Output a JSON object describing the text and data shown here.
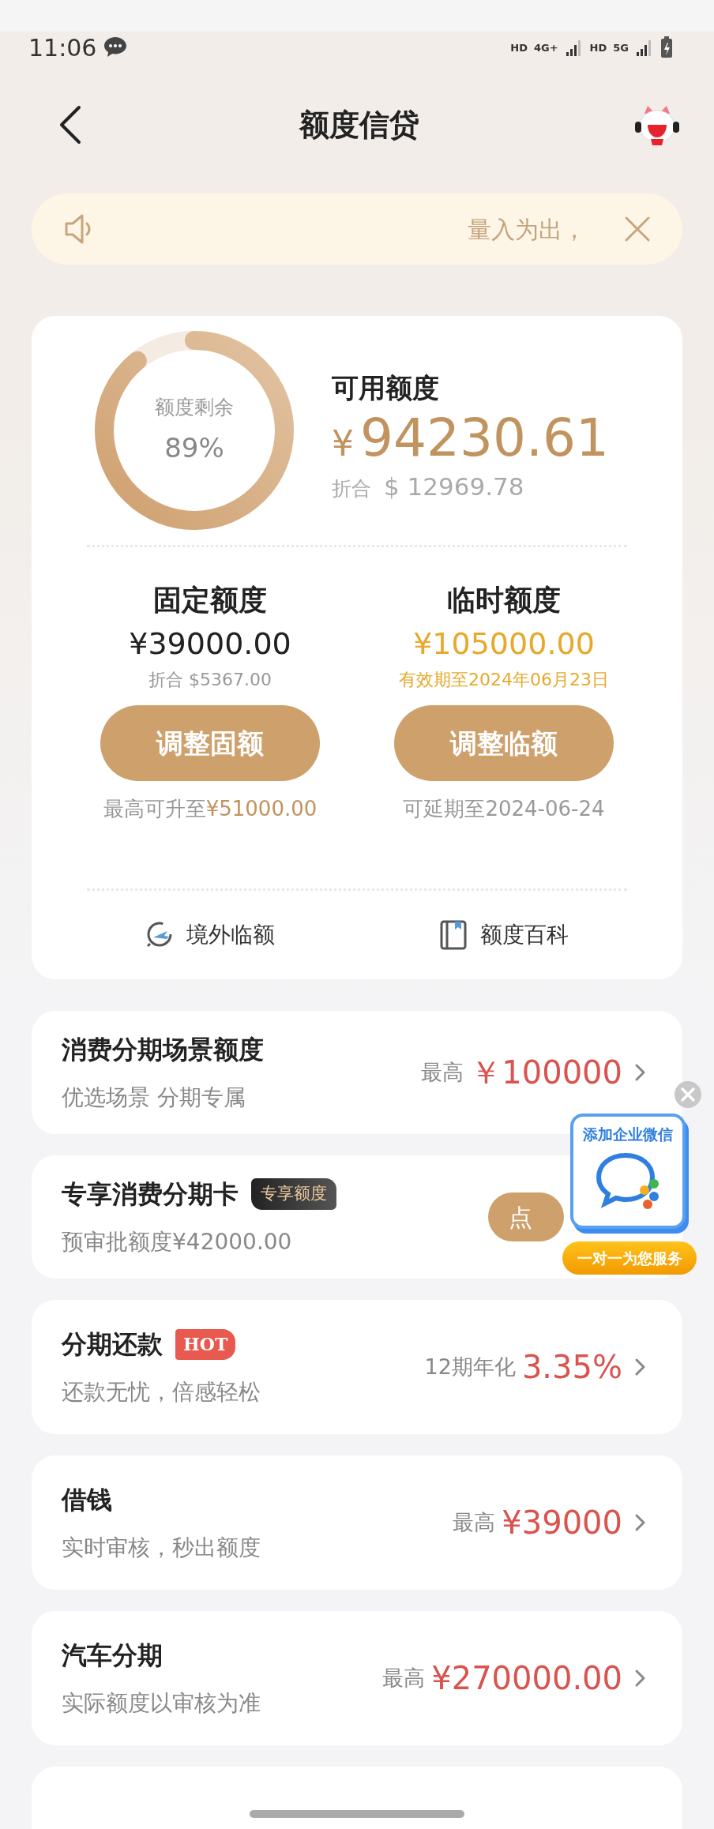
{
  "status_bar": {
    "time": "11:06",
    "indicators": [
      "HD",
      "4G+",
      "HD",
      "5G"
    ]
  },
  "header": {
    "title": "额度信贷"
  },
  "notice": {
    "text": "量入为出，"
  },
  "summary": {
    "ring_label": "额度剩余",
    "ring_value": "89%",
    "title": "可用额度",
    "currency": "¥",
    "amount": "94230.61",
    "converted_label": "折合",
    "converted_currency": "$",
    "converted_amount": "12969.78"
  },
  "limits": [
    {
      "title": "固定额度",
      "amount": "¥39000.00",
      "highlight": false,
      "sub": "折合 $5367.00",
      "button": "调整固额",
      "note": "最高可升至",
      "note_amount": "¥51000.00"
    },
    {
      "title": "临时额度",
      "amount": "¥105000.00",
      "highlight": true,
      "sub": "有效期至2024年06月23日",
      "button": "调整临额",
      "note": "可延期至2024-06-24"
    }
  ],
  "links": [
    {
      "kind": "plane",
      "label": "境外临额"
    },
    {
      "kind": "book",
      "label": "额度百科"
    }
  ],
  "products": [
    {
      "kind": "amount",
      "title": "消费分期场景额度",
      "subtitle": "优选场景 分期专属",
      "prefix": "最高",
      "value": "￥100000"
    },
    {
      "kind": "button",
      "title": "专享消费分期卡",
      "badge": {
        "kind": "tag",
        "text": "专享额度"
      },
      "subtitle": "预审批额度¥42000.00",
      "button": "点"
    },
    {
      "kind": "amount",
      "title": "分期还款",
      "badge": {
        "kind": "hot",
        "text": "HOT"
      },
      "subtitle": "还款无忧，倍感轻松",
      "prefix": "12期年化",
      "value": "3.35%"
    },
    {
      "kind": "amount",
      "title": "借钱",
      "subtitle": "实时审核，秒出额度",
      "prefix": "最高",
      "value": "¥39000"
    },
    {
      "kind": "amount",
      "title": "汽车分期",
      "subtitle": "实际额度以审核为准",
      "prefix": "最高",
      "value": "¥270000.00"
    },
    {
      "kind": "clipped"
    }
  ],
  "float_widget": {
    "title": "添加企业微信",
    "caption": "一对一为您服务"
  }
}
